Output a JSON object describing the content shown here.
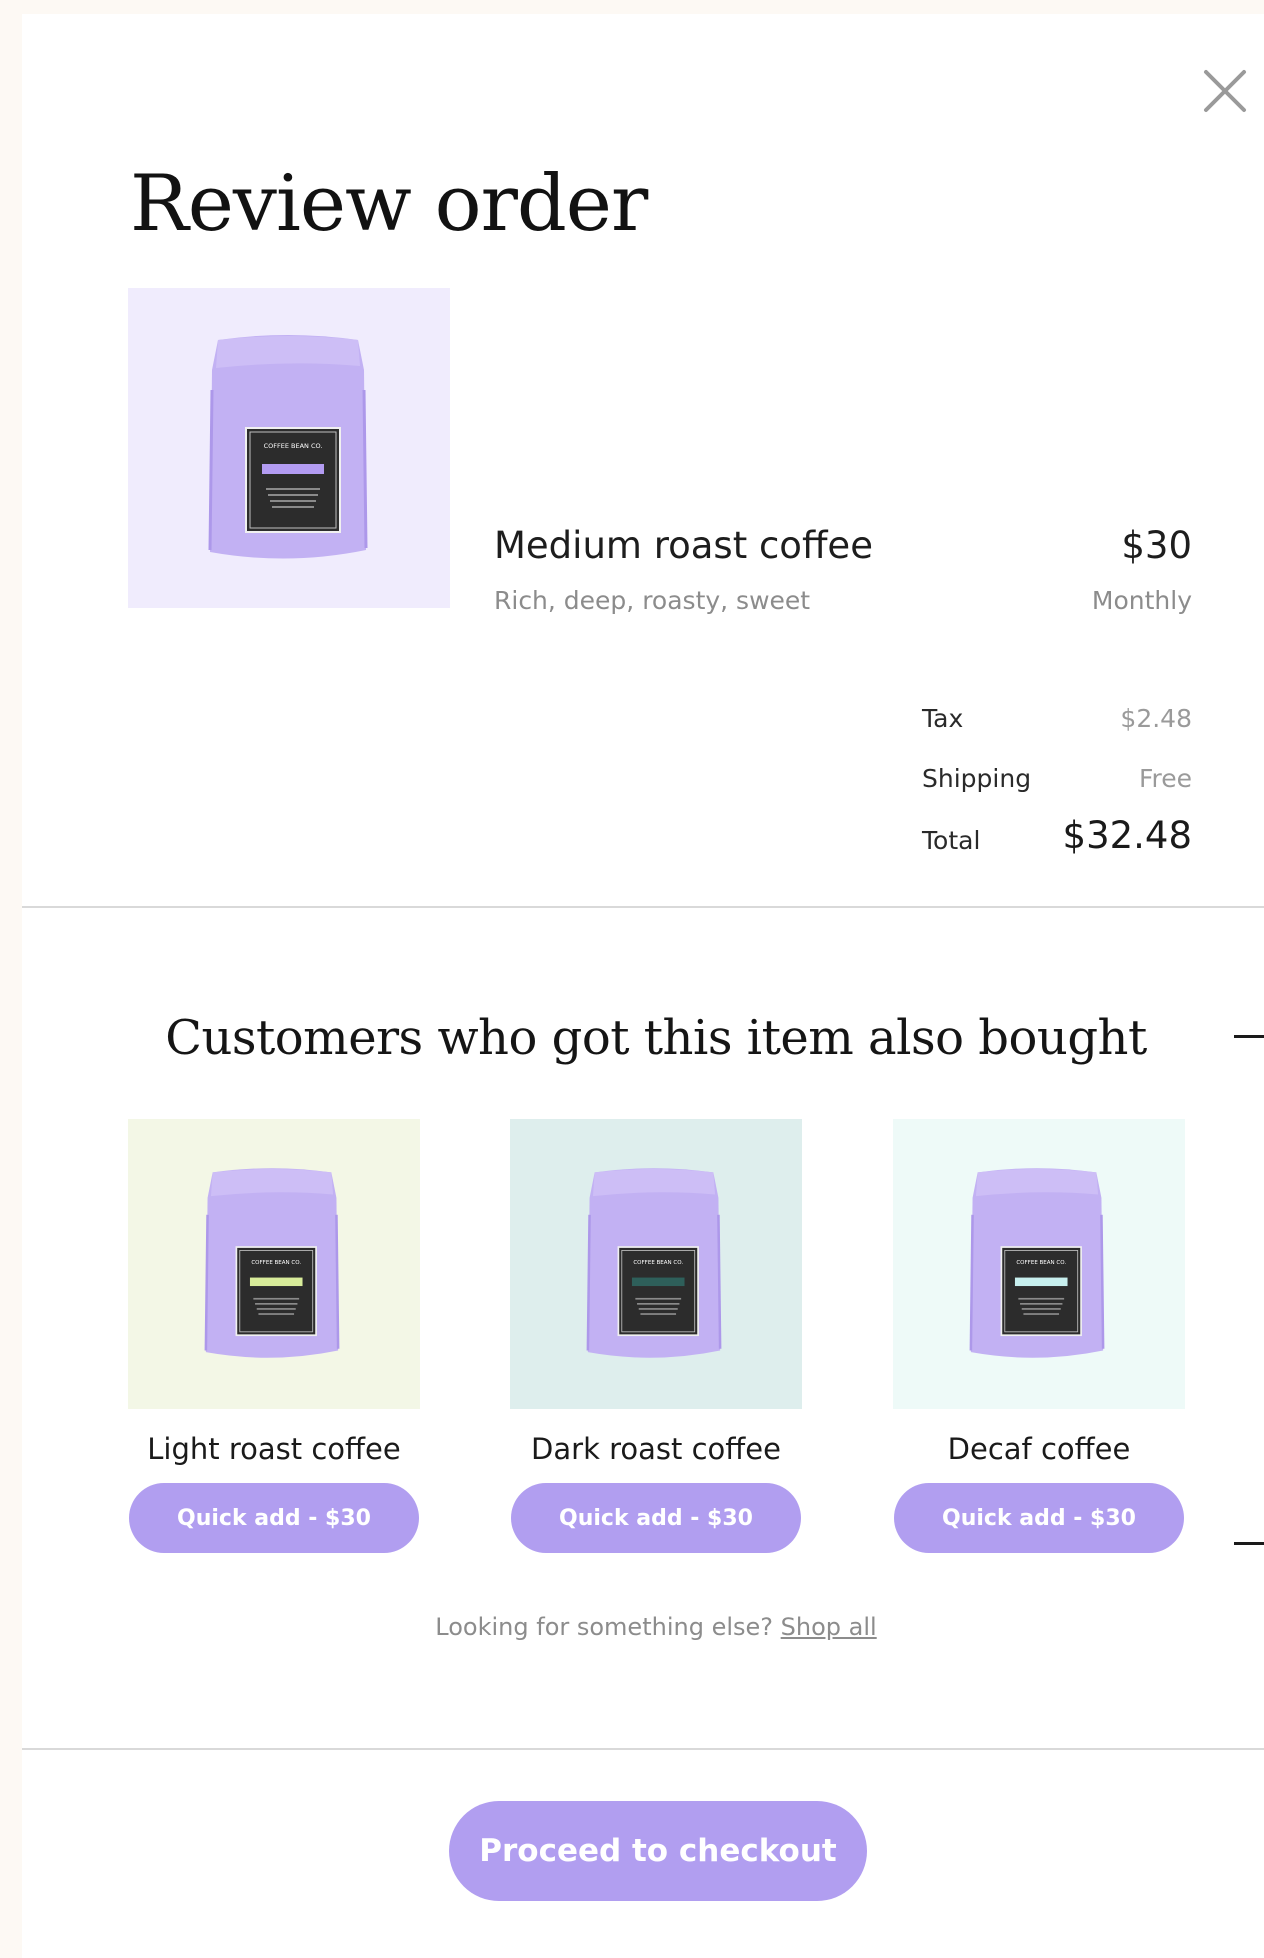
{
  "modal": {
    "title": "Review order",
    "close_icon": "close-icon"
  },
  "order_item": {
    "name": "Medium roast coffee",
    "description": "Rich, deep, roasty, sweet",
    "price": "$30",
    "frequency": "Monthly",
    "image_background": "#f0ecfd",
    "bag_label_text": "COFFEE BEAN CO.",
    "bag_tag_color": "#b39cf2"
  },
  "summary": {
    "tax_label": "Tax",
    "tax_value": "$2.48",
    "shipping_label": "Shipping",
    "shipping_value": "Free",
    "total_label": "Total",
    "total_value": "$32.48"
  },
  "recommendations": {
    "title": "Customers who got this item also bought",
    "items": [
      {
        "name": "Light roast coffee",
        "button_label": "Quick add - $30",
        "image_background": "#f3f7e6",
        "tag_color": "#d8ec9a",
        "bag_label_text": "COFFEE BEAN CO."
      },
      {
        "name": "Dark roast coffee",
        "button_label": "Quick add - $30",
        "image_background": "#deeeed",
        "tag_color": "#2e5f5a",
        "bag_label_text": "COFFEE BEAN CO."
      },
      {
        "name": "Decaf coffee",
        "button_label": "Quick add - $30",
        "image_background": "#eefaf8",
        "tag_color": "#c7efee",
        "bag_label_text": "COFFEE BEAN CO."
      }
    ],
    "footer_text": "Looking for something else?",
    "footer_link": "Shop all"
  },
  "checkout": {
    "button_label": "Proceed to checkout"
  },
  "colors": {
    "accent": "#b19ef0",
    "bag": "#c2b1f3",
    "divider": "#d9d9d9"
  }
}
